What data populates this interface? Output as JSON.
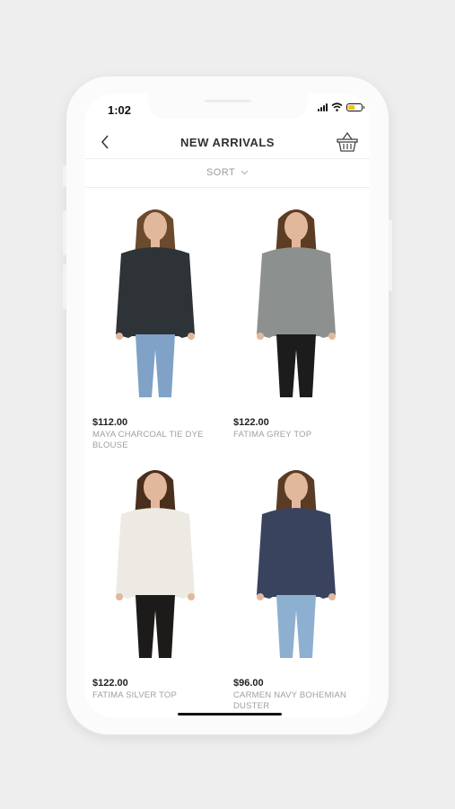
{
  "status_bar": {
    "time": "1:02"
  },
  "header": {
    "title": "NEW ARRIVALS",
    "back_icon": "chevron-left-icon",
    "cart_icon": "basket-icon"
  },
  "sort": {
    "label": "SORT",
    "icon": "chevron-down-icon"
  },
  "products": [
    {
      "price": "$112.00",
      "name": "MAYA CHARCOAL TIE DYE BLOUSE",
      "top_color": "#2d3337",
      "bottom_color": "#7fa2c6",
      "hair_color": "#6b4a2e"
    },
    {
      "price": "$122.00",
      "name": "FATIMA GREY TOP",
      "top_color": "#8c918f",
      "bottom_color": "#1c1c1c",
      "hair_color": "#5c3d24"
    },
    {
      "price": "$122.00",
      "name": "FATIMA SILVER TOP",
      "top_color": "#eceae3",
      "bottom_color": "#1d1b1a",
      "hair_color": "#4a2f1d"
    },
    {
      "price": "$96.00",
      "name": "CARMEN NAVY BOHEMIAN DUSTER",
      "top_color": "#39435e",
      "bottom_color": "#8db0d1",
      "hair_color": "#5a3b24"
    }
  ]
}
